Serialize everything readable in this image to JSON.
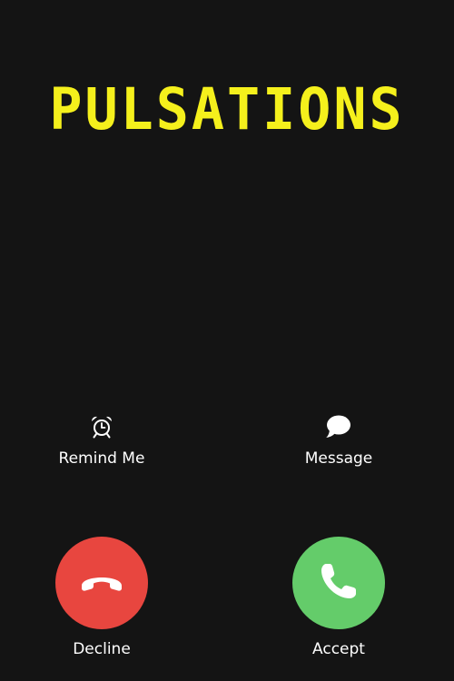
{
  "caller": {
    "name": "PULSATIONS"
  },
  "quick_actions": {
    "remind": {
      "label": "Remind Me",
      "icon": "alarm-clock-icon"
    },
    "message": {
      "label": "Message",
      "icon": "message-bubble-icon"
    }
  },
  "call_actions": {
    "decline": {
      "label": "Decline",
      "icon": "phone-hangup-icon"
    },
    "accept": {
      "label": "Accept",
      "icon": "phone-icon"
    }
  },
  "colors": {
    "background": "#141414",
    "title": "#f5f01c",
    "decline": "#e8463f",
    "accept": "#64cc6a"
  }
}
